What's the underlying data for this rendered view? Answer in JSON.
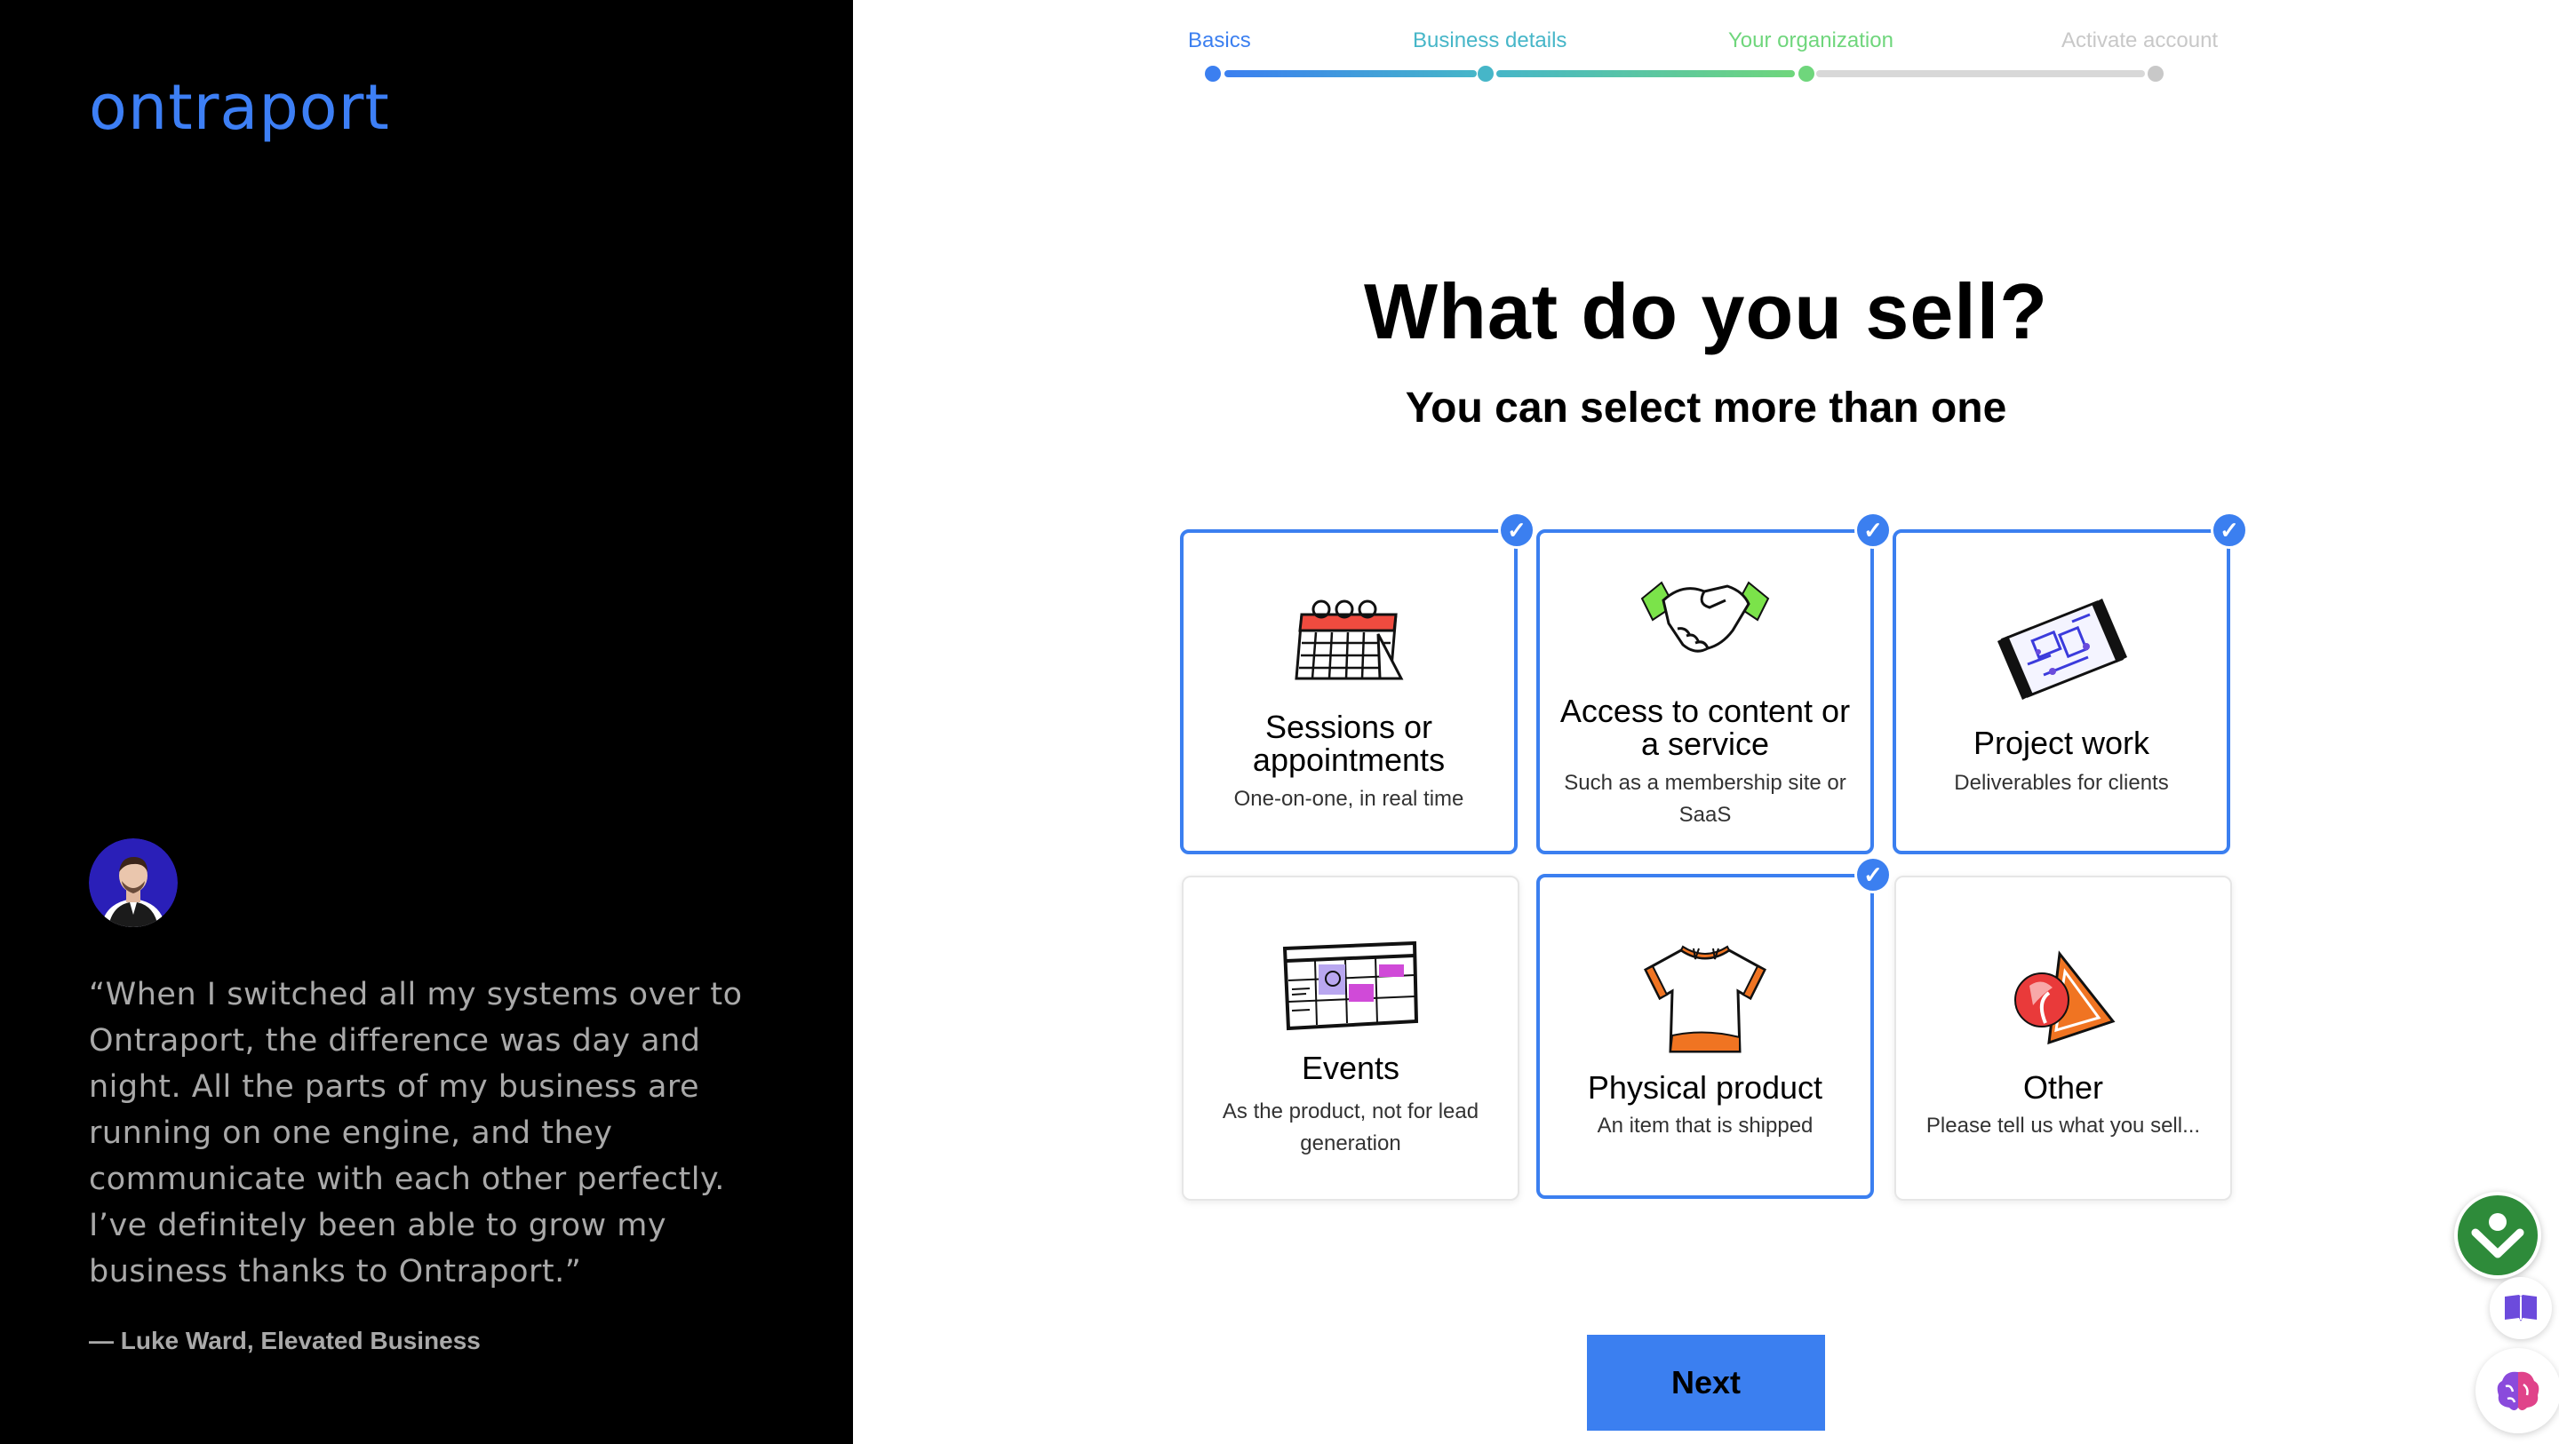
{
  "brand": {
    "logo": "ontraport",
    "logo_color": "#3d7ff5"
  },
  "testimonial": {
    "quote": "“When I switched all my systems over to Ontraport, the difference was day and night. All the parts of my business are running on one engine, and they communicate with each other perfectly. I’ve definitely been able to grow my business thanks to Ontraport.”",
    "attribution": "— Luke Ward, Elevated Business"
  },
  "progress": {
    "steps": [
      {
        "label": "Basics",
        "color": "#3b7ff0"
      },
      {
        "label": "Business details",
        "color": "#46b6c8"
      },
      {
        "label": "Your organization",
        "color": "#6fd67c"
      },
      {
        "label": "Activate account",
        "color": "#c8c8c8"
      }
    ]
  },
  "header": {
    "title": "What do you sell?",
    "subtitle": "You can select more than one"
  },
  "options": [
    {
      "title": "Sessions or appointments",
      "desc": "One-on-one, in real time",
      "selected": true,
      "icon": "calendar-icon"
    },
    {
      "title": "Access to content or a service",
      "desc": "Such as a membership site or SaaS",
      "selected": true,
      "icon": "handshake-icon"
    },
    {
      "title": "Project work",
      "desc": "Deliverables for clients",
      "selected": true,
      "icon": "blueprint-icon"
    },
    {
      "title": "Events",
      "desc": "As the product, not for lead generation",
      "selected": false,
      "icon": "event-schedule-icon"
    },
    {
      "title": "Physical product",
      "desc": "An item that is shipped",
      "selected": true,
      "icon": "tshirt-icon"
    },
    {
      "title": "Other",
      "desc": "Please tell us what you sell...",
      "selected": false,
      "icon": "shapes-icon"
    }
  ],
  "check_mark": "✓",
  "next_button": {
    "label": "Next"
  },
  "colors": {
    "accent": "#3b7ff0"
  }
}
